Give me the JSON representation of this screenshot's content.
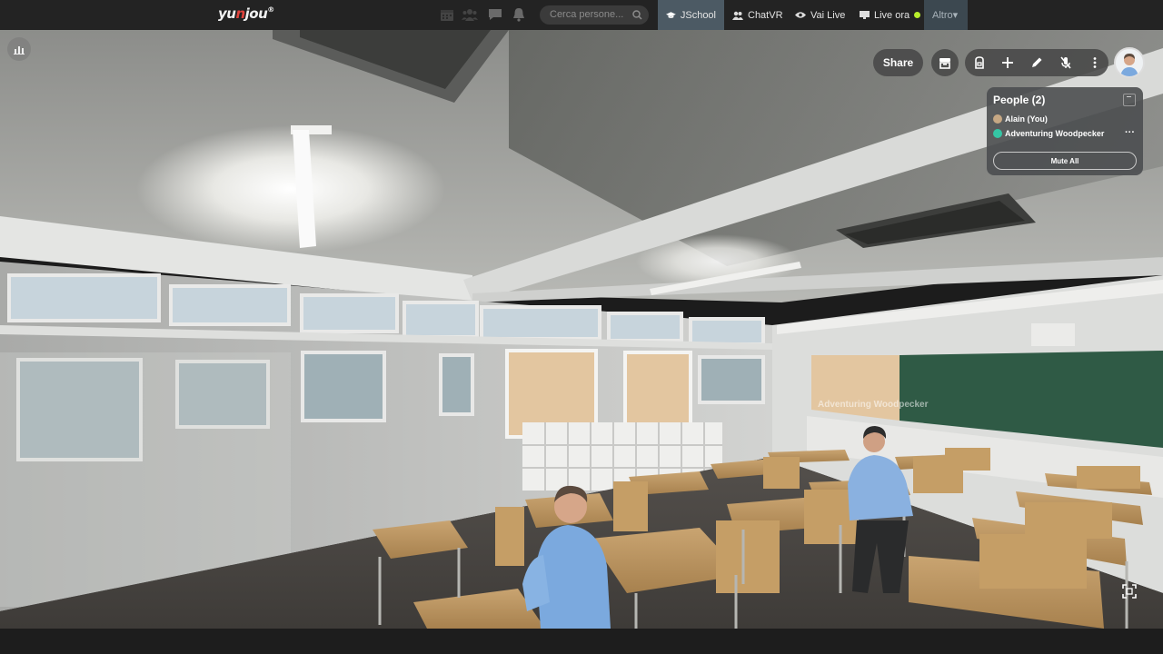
{
  "navbar": {
    "logo": {
      "part1": "yu",
      "part2": "n",
      "part3": "jou",
      "reg": "®"
    },
    "search_placeholder": "Cerca persone...",
    "tabs": [
      {
        "label": "JSchool",
        "icon": "graduation-cap-icon",
        "active": true
      },
      {
        "label": "ChatVR",
        "icon": "users-icon"
      },
      {
        "label": "Vai Live",
        "icon": "eye-icon"
      },
      {
        "label": "Live ora",
        "icon": "monitor-icon",
        "status_color": "#b7ee2b"
      },
      {
        "label": "Altro▾",
        "icon": ""
      }
    ],
    "icons": [
      "calendar-icon",
      "users-group-icon",
      "chat-icon",
      "bell-icon",
      "search-icon"
    ]
  },
  "scene": {
    "nametag": "Adventuring Woodpecker"
  },
  "toolbar": {
    "share_label": "Share",
    "icons": [
      "inventory-icon",
      "backpack-icon",
      "plus-icon",
      "pen-icon",
      "mic-muted-icon",
      "more-vertical-icon"
    ]
  },
  "people": {
    "title": "People (2)",
    "members": [
      {
        "name": "Alain (You)",
        "color": "#c7a884"
      },
      {
        "name": "Adventuring Woodpecker",
        "color": "#35c6a5"
      }
    ],
    "mute_all_label": "Mute All"
  },
  "colors": {
    "navbar": "#232323",
    "active_tab": "#4c5a64",
    "chalkboard": "#2f5a45"
  }
}
